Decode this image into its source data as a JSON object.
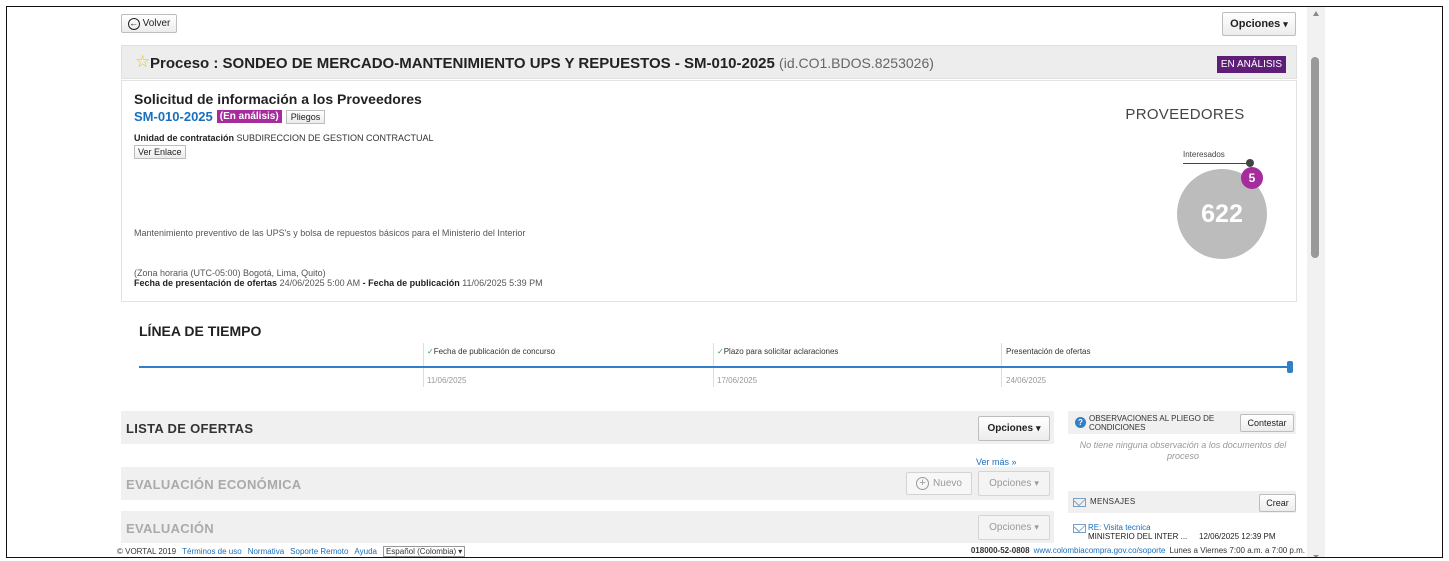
{
  "toolbar": {
    "back_label": "Volver",
    "options_label": "Opciones"
  },
  "process": {
    "prefix": "Proceso : ",
    "title": "SONDEO DE MERCADO-MANTENIMIENTO UPS Y REPUESTOS - SM-010-2025",
    "id": "(id.CO1.BDOS.8253026)",
    "status_badge": "EN ANÁLISIS"
  },
  "info": {
    "solicitud_title": "Solicitud de información a los Proveedores",
    "reference": "SM-010-2025",
    "reference_status": "(En análisis)",
    "pliegos_label": "Pliegos",
    "unidad_label": "Unidad de contratación",
    "unidad_value": "SUBDIRECCION DE GESTION CONTRACTUAL",
    "ver_enlace_label": "Ver Enlace",
    "description": "Mantenimiento preventivo de las UPS's y bolsa de repuestos básicos para el Ministerio del Interior",
    "timezone": "(Zona horaria (UTC-05:00) Bogotá, Lima, Quito)",
    "fecha_presentacion_label": "Fecha de presentación de ofertas",
    "fecha_presentacion_value": "24/06/2025 5:00 AM",
    "separator": "-",
    "fecha_publicacion_label": "Fecha de publicación",
    "fecha_publicacion_value": "11/06/2025 5:39 PM"
  },
  "proveedores": {
    "title": "PROVEEDORES",
    "interesados_label": "Interesados",
    "interesados_count": "5",
    "total": "622"
  },
  "timeline": {
    "title": "LÍNEA DE TIEMPO",
    "steps": [
      {
        "label": "Fecha de publicación de concurso",
        "date": "11/06/2025",
        "done": "true"
      },
      {
        "label": "Plazo para solicitar aclaraciones",
        "date": "17/06/2025",
        "done": "true"
      },
      {
        "label": "Presentación de ofertas",
        "date": "24/06/2025",
        "done": "false"
      }
    ]
  },
  "sections": {
    "lista_ofertas": {
      "title": "LISTA DE OFERTAS",
      "options_label": "Opciones"
    },
    "ver_mas": "Ver más »",
    "evaluacion_economica": {
      "title": "EVALUACIÓN ECONÓMICA",
      "nuevo_label": "Nuevo",
      "options_label": "Opciones"
    },
    "evaluacion": {
      "title": "EVALUACIÓN",
      "options_label": "Opciones"
    }
  },
  "observaciones": {
    "title": "OBSERVACIONES AL PLIEGO DE CONDICIONES",
    "contestar_label": "Contestar",
    "empty_text": "No tiene ninguna observación a los documentos del proceso"
  },
  "mensajes": {
    "title": "MENSAJES",
    "crear_label": "Crear",
    "items": [
      {
        "subject": "RE: Visita tecnica",
        "from": "MINISTERIO DEL INTER ...",
        "date": "12/06/2025 12:39 PM"
      }
    ]
  },
  "footer": {
    "copyright": "© VORTAL 2019",
    "links": [
      "Términos de uso",
      "Normativa",
      "Soporte Remoto",
      "Ayuda"
    ],
    "language": "Español (Colombia)",
    "phone": "018000-52-0808",
    "support_url": "www.colombiacompra.gov.co/soporte",
    "hours": "Lunes a Viernes 7:00 a.m. a 7:00 p.m."
  },
  "colors": {
    "badge_purple": "#5e1e78",
    "accent_magenta": "#a62b9c",
    "link_blue": "#1a6fbd",
    "timeline_blue": "#2f7fc9",
    "circle_gray": "#bcbcbc"
  },
  "icons": [
    "back-arrow-icon",
    "star-icon",
    "chevron-down-icon",
    "check-icon",
    "plus-circle-icon",
    "question-icon",
    "envelope-icon"
  ]
}
